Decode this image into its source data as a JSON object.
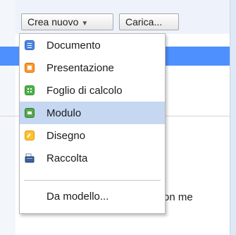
{
  "toolbar": {
    "create_label": "Crea nuovo",
    "upload_label": "Carica..."
  },
  "menu": {
    "items": [
      {
        "label": "Documento",
        "icon": "document-icon"
      },
      {
        "label": "Presentazione",
        "icon": "presentation-icon"
      },
      {
        "label": "Foglio di calcolo",
        "icon": "spreadsheet-icon"
      },
      {
        "label": "Modulo",
        "icon": "form-icon",
        "highlighted": true
      },
      {
        "label": "Disegno",
        "icon": "drawing-icon"
      },
      {
        "label": "Raccolta",
        "icon": "collection-icon"
      }
    ],
    "from_template_label": "Da modello..."
  },
  "background": {
    "partial_text": "on me"
  },
  "colors": {
    "highlight": "#c6d7f2",
    "blue_bar": "#4d90fe"
  }
}
